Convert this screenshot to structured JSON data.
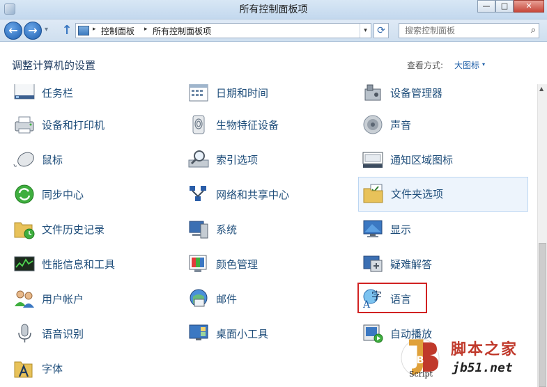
{
  "window": {
    "title": "所有控制面板项",
    "buttons": {
      "minimize": "—",
      "maximize": "□",
      "close": "✕"
    }
  },
  "nav": {
    "back": "←",
    "forward": "→",
    "recent": "▾",
    "up": "↑",
    "breadcrumb": [
      "控制面板",
      "所有控制面板项"
    ],
    "breadcrumb_sep": "▸",
    "address_dropdown": "▾",
    "refresh": "⟳",
    "search_placeholder": "搜索控制面板",
    "search_icon": "⌕"
  },
  "header": {
    "title": "调整计算机的设置",
    "view_label": "查看方式:",
    "view_value": "大图标",
    "view_dropdown": "▾"
  },
  "items": [
    {
      "label": "任务栏",
      "icon": "taskbar-icon"
    },
    {
      "label": "日期和时间",
      "icon": "date-time-icon"
    },
    {
      "label": "设备管理器",
      "icon": "device-manager-icon"
    },
    {
      "label": "设备和打印机",
      "icon": "devices-printers-icon"
    },
    {
      "label": "生物特征设备",
      "icon": "biometric-icon"
    },
    {
      "label": "声音",
      "icon": "sound-icon"
    },
    {
      "label": "鼠标",
      "icon": "mouse-icon"
    },
    {
      "label": "索引选项",
      "icon": "indexing-icon"
    },
    {
      "label": "通知区域图标",
      "icon": "notification-icon"
    },
    {
      "label": "同步中心",
      "icon": "sync-icon"
    },
    {
      "label": "网络和共享中心",
      "icon": "network-icon"
    },
    {
      "label": "文件夹选项",
      "icon": "folder-options-icon"
    },
    {
      "label": "文件历史记录",
      "icon": "file-history-icon"
    },
    {
      "label": "系统",
      "icon": "system-icon"
    },
    {
      "label": "显示",
      "icon": "display-icon"
    },
    {
      "label": "性能信息和工具",
      "icon": "performance-icon"
    },
    {
      "label": "颜色管理",
      "icon": "color-management-icon"
    },
    {
      "label": "疑难解答",
      "icon": "troubleshooting-icon"
    },
    {
      "label": "用户帐户",
      "icon": "user-accounts-icon"
    },
    {
      "label": "邮件",
      "icon": "mail-icon"
    },
    {
      "label": "语言",
      "icon": "language-icon"
    },
    {
      "label": "语音识别",
      "icon": "speech-icon"
    },
    {
      "label": "桌面小工具",
      "icon": "gadgets-icon"
    },
    {
      "label": "自动播放",
      "icon": "autoplay-icon"
    },
    {
      "label": "字体",
      "icon": "fonts-icon"
    }
  ],
  "language_icon_glyphs": {
    "top": "字",
    "bottom": "A"
  },
  "selected_item": "文件夹选项",
  "highlighted_item": "语言",
  "scrollbar": {
    "up_arrow": "▲"
  },
  "watermark": {
    "logo_text": "jB",
    "script": "Script",
    "site_cn": "脚本之家",
    "site_url": "jb51.net"
  }
}
